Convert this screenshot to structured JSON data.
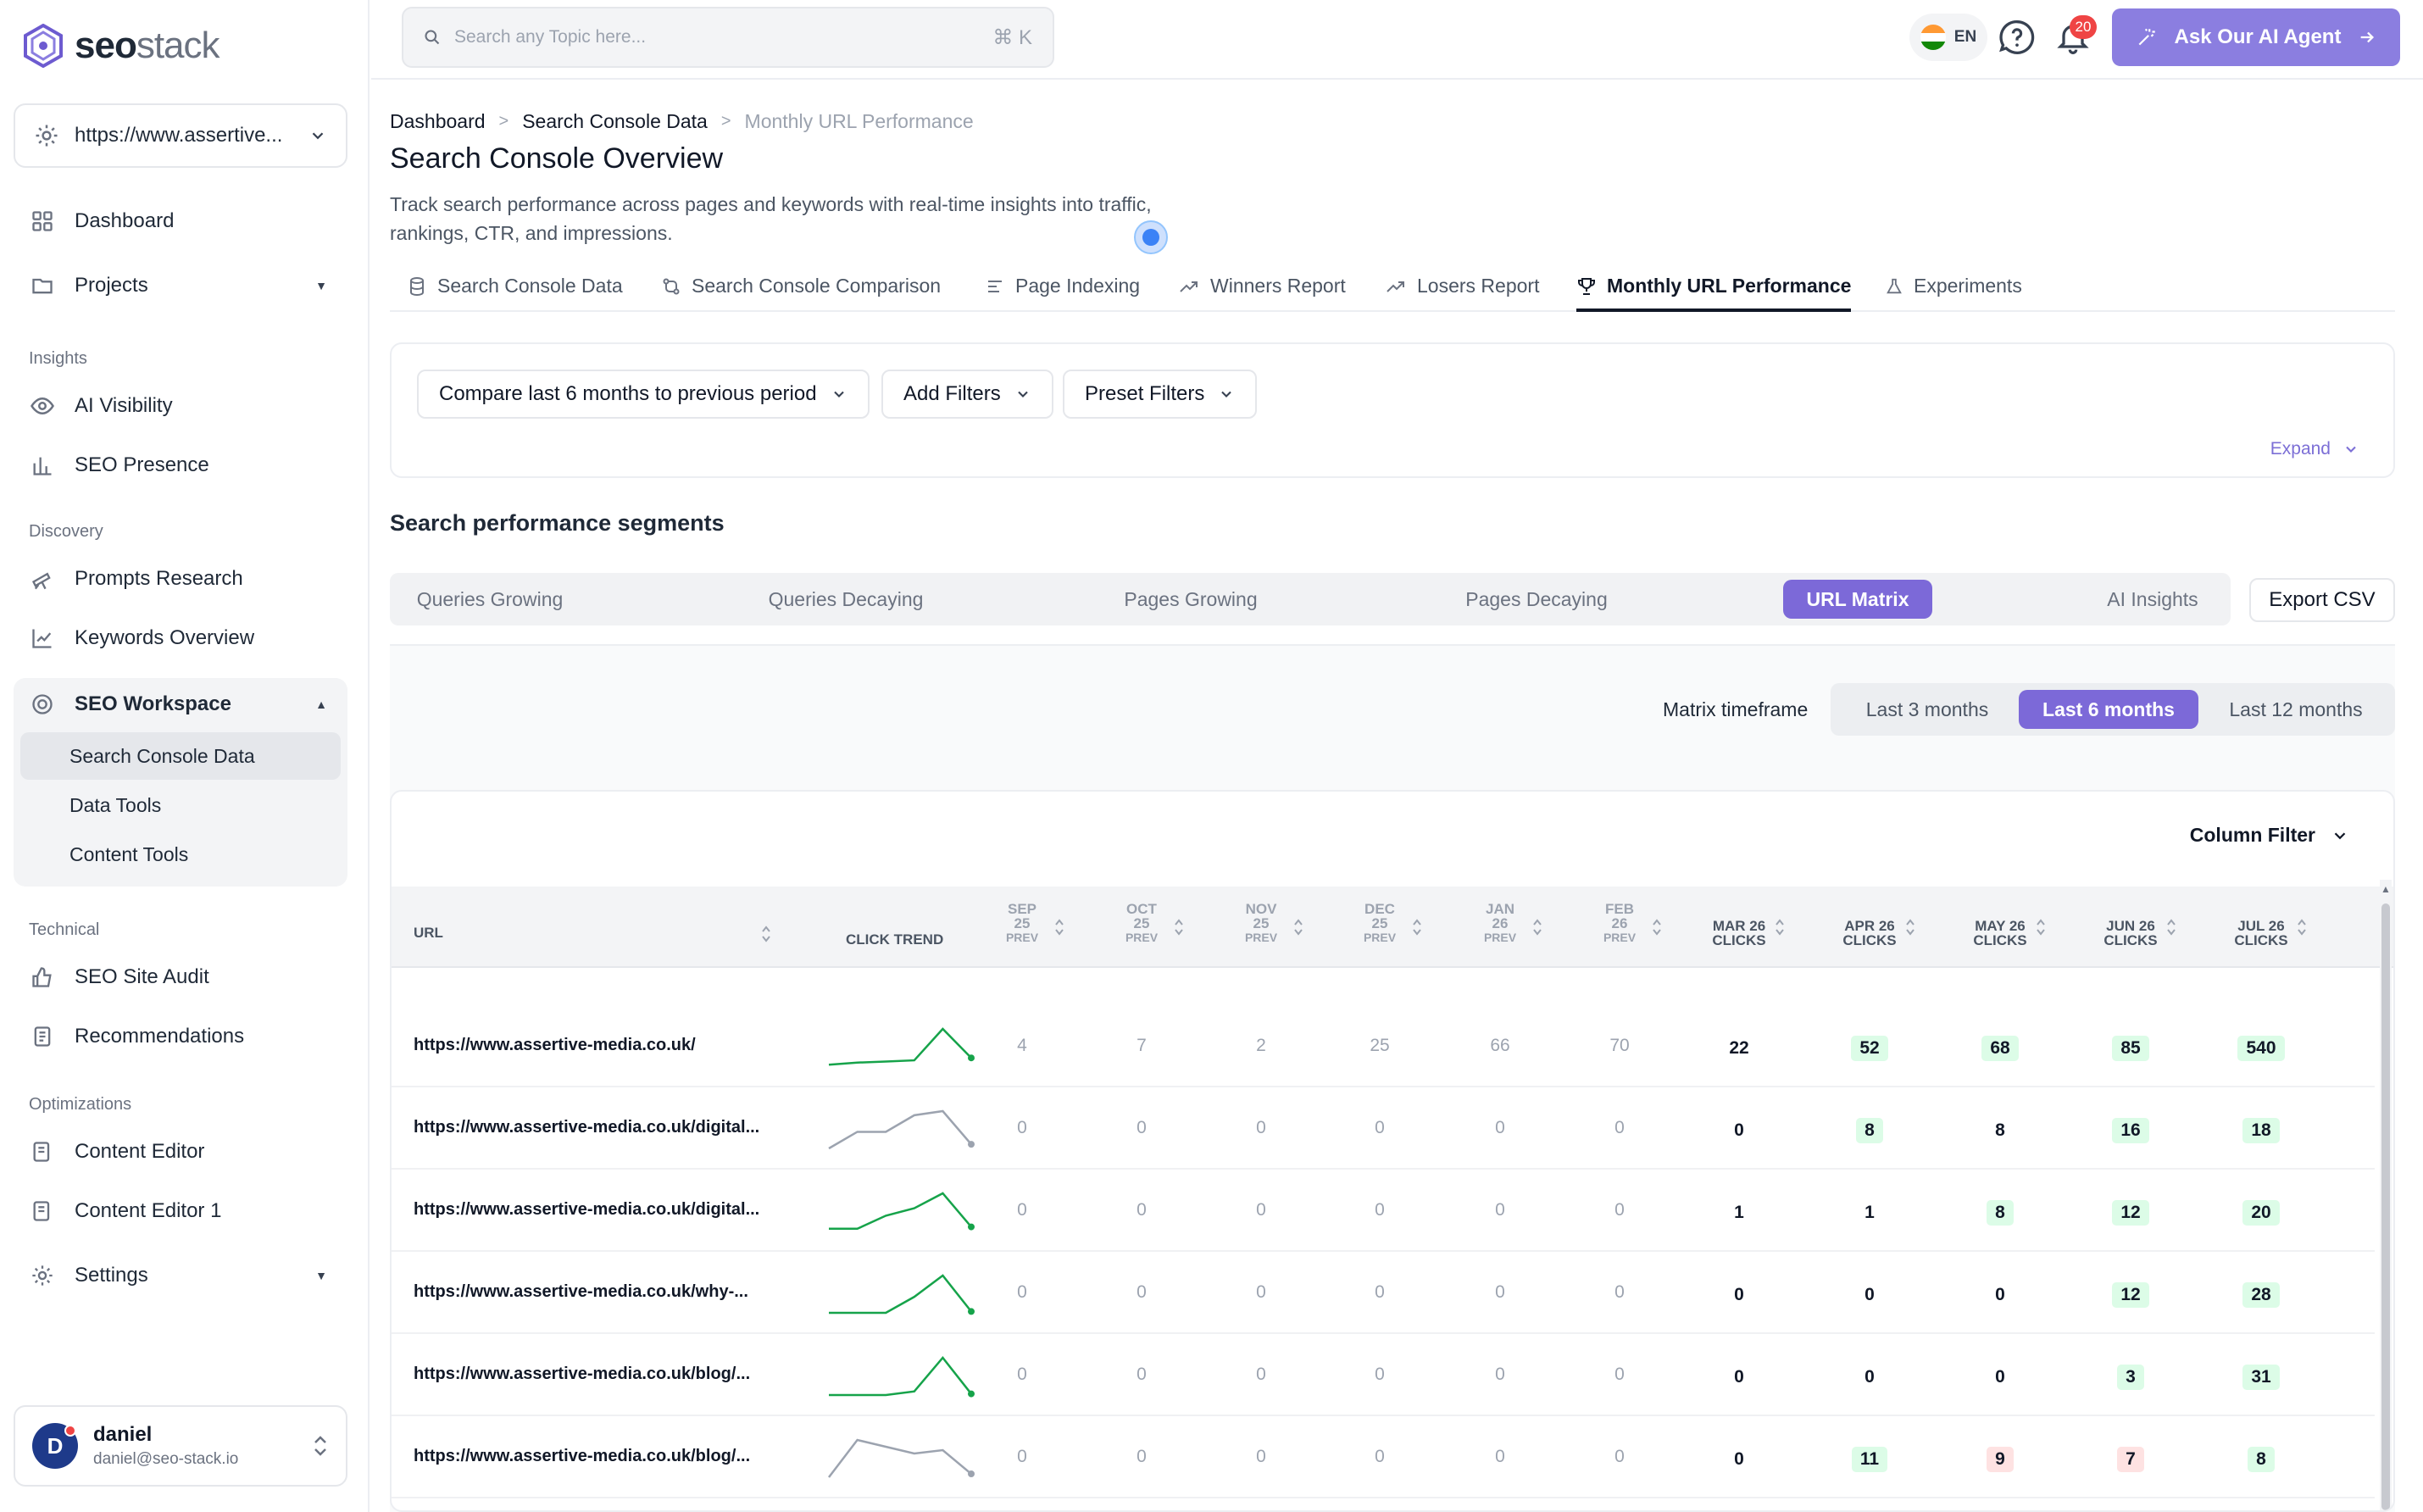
{
  "brand": {
    "name_bold": "seo",
    "name_light": "stack"
  },
  "site_selector": {
    "value": "https://www.assertive..."
  },
  "sidebar": {
    "dashboard": "Dashboard",
    "projects": "Projects",
    "insights_label": "Insights",
    "ai_visibility": "AI Visibility",
    "seo_presence": "SEO Presence",
    "discovery_label": "Discovery",
    "prompts_research": "Prompts Research",
    "keywords_overview": "Keywords Overview",
    "seo_workspace": "SEO Workspace",
    "workspace_items": [
      "Search Console Data",
      "Data Tools",
      "Content Tools"
    ],
    "technical_label": "Technical",
    "seo_site_audit": "SEO Site Audit",
    "recommendations": "Recommendations",
    "optimizations_label": "Optimizations",
    "content_editor": "Content Editor",
    "content_editor_1": "Content Editor 1",
    "settings": "Settings"
  },
  "user": {
    "initial": "D",
    "name": "daniel",
    "email": "daniel@seo-stack.io"
  },
  "topbar": {
    "search_placeholder": "Search any Topic here...",
    "shortcut": "⌘ K",
    "language": "EN",
    "notifications_count": "20",
    "ai_button": "Ask Our AI Agent"
  },
  "breadcrumb": [
    "Dashboard",
    "Search Console Data",
    "Monthly URL Performance"
  ],
  "page": {
    "title": "Search Console Overview",
    "description": "Track search performance across pages and keywords with real-time insights into traffic, rankings, CTR, and impressions."
  },
  "tabs": [
    "Search Console Data",
    "Search Console Comparison",
    "Page Indexing",
    "Winners Report",
    "Losers Report",
    "Monthly URL Performance",
    "Experiments"
  ],
  "filters": {
    "compare": "Compare last 6 months to previous period",
    "add_filters": "Add Filters",
    "preset_filters": "Preset Filters",
    "expand": "Expand"
  },
  "segments": {
    "title": "Search performance segments",
    "items": [
      "Queries Growing",
      "Queries Decaying",
      "Pages Growing",
      "Pages Decaying",
      "URL Matrix",
      "AI Insights"
    ],
    "active": "URL Matrix",
    "export": "Export CSV"
  },
  "timeframe": {
    "label": "Matrix timeframe",
    "options": [
      "Last 3 months",
      "Last 6 months",
      "Last 12 months"
    ],
    "active": "Last 6 months"
  },
  "table": {
    "column_filter": "Column Filter",
    "url_header": "URL",
    "trend_header": "CLICK TREND",
    "prev_cols": [
      {
        "m": "SEP",
        "y": "25",
        "t": "PREV"
      },
      {
        "m": "OCT",
        "y": "25",
        "t": "PREV"
      },
      {
        "m": "NOV",
        "y": "25",
        "t": "PREV"
      },
      {
        "m": "DEC",
        "y": "25",
        "t": "PREV"
      },
      {
        "m": "JAN",
        "y": "26",
        "t": "PREV"
      },
      {
        "m": "FEB",
        "y": "26",
        "t": "PREV"
      }
    ],
    "cur_cols": [
      {
        "a": "MAR 26",
        "b": "CLICKS"
      },
      {
        "a": "APR 26",
        "b": "CLICKS"
      },
      {
        "a": "MAY 26",
        "b": "CLICKS"
      },
      {
        "a": "JUN 26",
        "b": "CLICKS"
      },
      {
        "a": "JUL 26",
        "b": "CLICKS"
      }
    ],
    "rows": [
      {
        "url": "https://www.assertive-media.co.uk/",
        "prev": [
          "4",
          "7",
          "2",
          "25",
          "66",
          "70"
        ],
        "cur": [
          "22",
          "52",
          "68",
          "85",
          "540"
        ],
        "tone": [
          "n",
          "g",
          "g",
          "g",
          "g"
        ],
        "trend": [
          22,
          52,
          68,
          85,
          540,
          120
        ],
        "color": "#16a34a"
      },
      {
        "url": "https://www.assertive-media.co.uk/digital...",
        "prev": [
          "0",
          "0",
          "0",
          "0",
          "0",
          "0"
        ],
        "cur": [
          "0",
          "8",
          "8",
          "16",
          "18"
        ],
        "tone": [
          "n",
          "g",
          "n",
          "g",
          "g"
        ],
        "trend": [
          0,
          8,
          8,
          16,
          18,
          2
        ],
        "color": "#9ca3af"
      },
      {
        "url": "https://www.assertive-media.co.uk/digital...",
        "prev": [
          "0",
          "0",
          "0",
          "0",
          "0",
          "0"
        ],
        "cur": [
          "1",
          "1",
          "8",
          "12",
          "20"
        ],
        "tone": [
          "n",
          "n",
          "g",
          "g",
          "g"
        ],
        "trend": [
          1,
          1,
          8,
          12,
          20,
          2
        ],
        "color": "#16a34a"
      },
      {
        "url": "https://www.assertive-media.co.uk/why-...",
        "prev": [
          "0",
          "0",
          "0",
          "0",
          "0",
          "0"
        ],
        "cur": [
          "0",
          "0",
          "0",
          "12",
          "28"
        ],
        "tone": [
          "n",
          "n",
          "n",
          "g",
          "g"
        ],
        "trend": [
          0,
          0,
          0,
          12,
          28,
          1
        ],
        "color": "#16a34a"
      },
      {
        "url": "https://www.assertive-media.co.uk/blog/...",
        "prev": [
          "0",
          "0",
          "0",
          "0",
          "0",
          "0"
        ],
        "cur": [
          "0",
          "0",
          "0",
          "3",
          "31"
        ],
        "tone": [
          "n",
          "n",
          "n",
          "g",
          "g"
        ],
        "trend": [
          0,
          0,
          0,
          3,
          31,
          1
        ],
        "color": "#16a34a"
      },
      {
        "url": "https://www.assertive-media.co.uk/blog/...",
        "prev": [
          "0",
          "0",
          "0",
          "0",
          "0",
          "0"
        ],
        "cur": [
          "0",
          "11",
          "9",
          "7",
          "8"
        ],
        "tone": [
          "n",
          "g",
          "r",
          "r",
          "g"
        ],
        "trend": [
          0,
          11,
          9,
          7,
          8,
          1
        ],
        "color": "#9ca3af"
      }
    ]
  }
}
